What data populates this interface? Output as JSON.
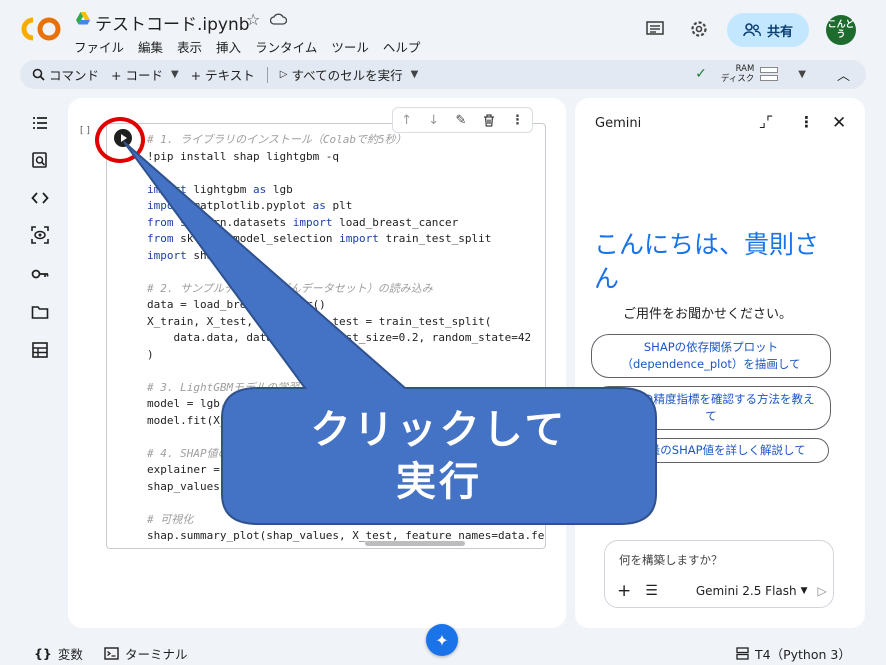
{
  "header": {
    "filename": "テストコード.ipynb",
    "menu": [
      "ファイル",
      "編集",
      "表示",
      "挿入",
      "ランタイム",
      "ツール",
      "ヘルプ"
    ],
    "share_label": "共有",
    "avatar_text": "こんどう"
  },
  "toolbar": {
    "command": "コマンド",
    "code": "+ コード",
    "text": "+ テキスト",
    "run_all": "すべてのセルを実行",
    "ram": "RAM",
    "disk": "ディスク"
  },
  "cell": {
    "bracket": "[ ]",
    "lines": [
      {
        "t": "cm",
        "s": "# 1. ライブラリのインストール（Colabで約5秒）"
      },
      {
        "t": "plain",
        "s": "!pip install shap lightgbm -q"
      },
      {
        "t": "plain",
        "s": ""
      },
      {
        "t": "mix",
        "s": "import lightgbm as lgb"
      },
      {
        "t": "mix",
        "s": "import matplotlib.pyplot as plt"
      },
      {
        "t": "mix",
        "s": "from sklearn.datasets import load_breast_cancer"
      },
      {
        "t": "mix",
        "s": "from sklearn.model_selection import train_test_split"
      },
      {
        "t": "mix",
        "s": "import shap"
      },
      {
        "t": "plain",
        "s": ""
      },
      {
        "t": "cm",
        "s": "# 2. サンプルデータ（乳がんデータセット）の読み込み"
      },
      {
        "t": "plain",
        "s": "data = load_breast_cancer()"
      },
      {
        "t": "plain",
        "s": "X_train, X_test, y_train, y_test = train_test_split("
      },
      {
        "t": "plain",
        "s": "    data.data, data.target, test_size=0.2, random_state=42"
      },
      {
        "t": "plain",
        "s": ")"
      },
      {
        "t": "plain",
        "s": ""
      },
      {
        "t": "cm",
        "s": "# 3. LightGBMモデルの学習"
      },
      {
        "t": "plain",
        "s": "model = lgb.LGBMClassifier()"
      },
      {
        "t": "plain",
        "s": "model.fit(X_train, y_train)"
      },
      {
        "t": "plain",
        "s": ""
      },
      {
        "t": "cm",
        "s": "# 4. SHAP値の計算"
      },
      {
        "t": "plain",
        "s": "explainer = shap.TreeExplainer(model)"
      },
      {
        "t": "plain",
        "s": "shap_values = explainer.shap_values(X_test)"
      },
      {
        "t": "plain",
        "s": ""
      },
      {
        "t": "cm",
        "s": "# 可視化"
      },
      {
        "t": "plain",
        "s": "shap.summary_plot(shap_values, X_test, feature_names=data.feature"
      }
    ]
  },
  "gemini": {
    "title": "Gemini",
    "greeting": "こんにちは、貴則さん",
    "subtitle": "ご用件をお聞かせください。",
    "chips": [
      "SHAPの依存関係プロット（dependence_plot）を描画して",
      "モデルの精度指標を確認する方法を教えて",
      "各特徴量のSHAP値を詳しく解説して"
    ],
    "input_placeholder": "何を構築しますか？",
    "model": "Gemini 2.5 Flash"
  },
  "status": {
    "variables": "変数",
    "terminal": "ターミナル",
    "runtime": "T4（Python 3）"
  },
  "annotation": {
    "line1": "クリックして",
    "line2": "実行"
  },
  "colors": {
    "accent": "#1a73e8",
    "callout": "#4472c4",
    "highlight": "#e00000"
  }
}
